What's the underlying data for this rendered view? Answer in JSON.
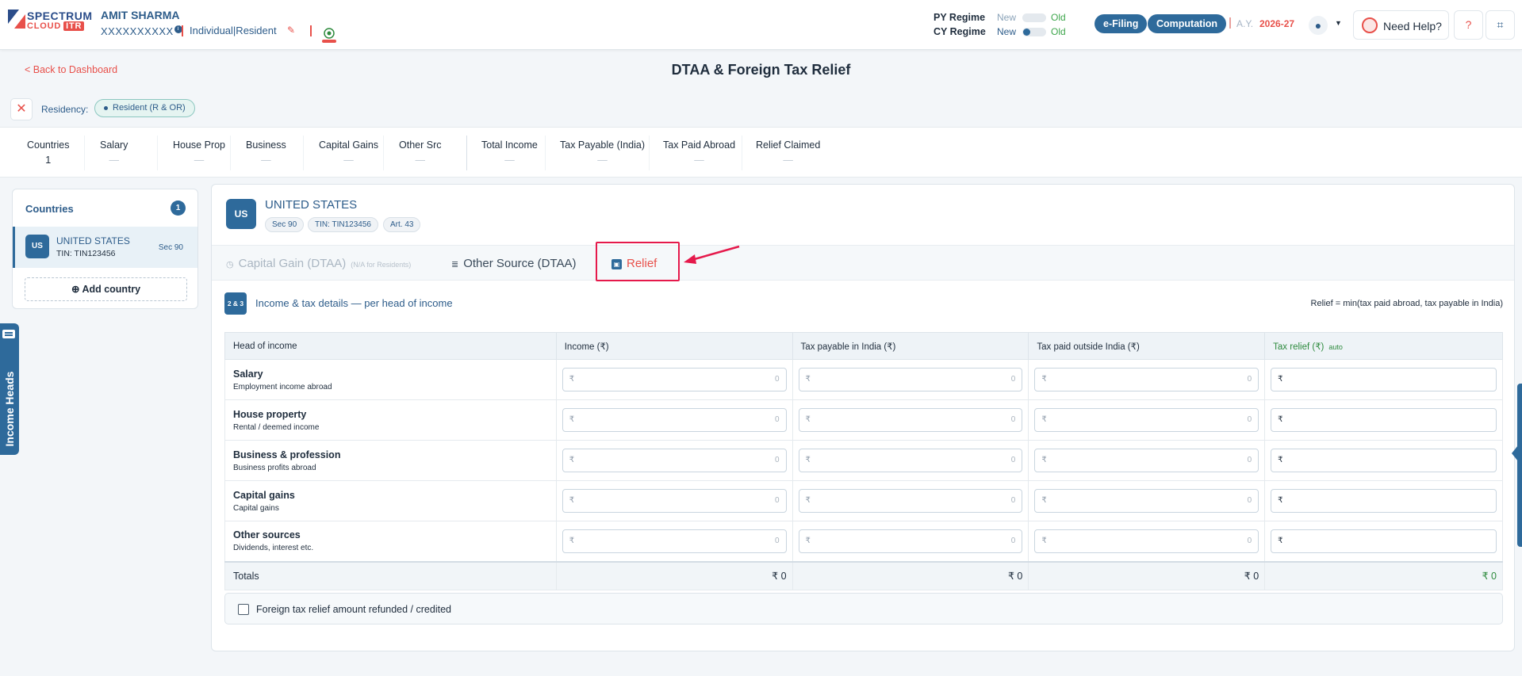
{
  "header": {
    "logo_line1": "SPECTRUM",
    "logo_line2": "CLOUD",
    "logo_badge": "ITR",
    "user_name": "AMIT SHARMA",
    "user_pan": "XXXXXXXXXX",
    "pan_badge": "i",
    "user_type": "Individual|Resident",
    "py_regime_label": "PY Regime",
    "cy_regime_label": "CY Regime",
    "new_label": "New",
    "old_label": "Old",
    "efiling_label": "e-Filing",
    "computation_label": "Computation",
    "ay_label": "A.Y.",
    "ay_value": "2026-27",
    "help_label": "Need Help?"
  },
  "page": {
    "back_label": "< Back to Dashboard",
    "title": "DTAA & Foreign Tax Relief",
    "residency_label": "Residency:",
    "residency_value": "Resident (R & OR)"
  },
  "summary": [
    {
      "label": "Countries",
      "value": "1"
    },
    {
      "label": "Salary",
      "value": "—"
    },
    {
      "label": "House Prop",
      "value": "—"
    },
    {
      "label": "Business",
      "value": "—"
    },
    {
      "label": "Capital Gains",
      "value": "—"
    },
    {
      "label": "Other Src",
      "value": "—"
    },
    {
      "label": "Total Income",
      "value": "—"
    },
    {
      "label": "Tax Payable (India)",
      "value": "—"
    },
    {
      "label": "Tax Paid Abroad",
      "value": "—"
    },
    {
      "label": "Relief Claimed",
      "value": "—"
    }
  ],
  "sidebar": {
    "title": "Countries",
    "count": "1",
    "country_code": "US",
    "country_name": "UNITED STATES",
    "country_tin": "TIN: TIN123456",
    "country_sec": "Sec 90",
    "add_label": "Add country",
    "side_tab_label": "Income Heads"
  },
  "country": {
    "code": "US",
    "name": "UNITED STATES",
    "chips": [
      "Sec 90",
      "TIN: TIN123456",
      "Art. 43"
    ]
  },
  "tabs": {
    "capital_gain": "Capital Gain (DTAA)",
    "capital_gain_note": "(N/A for Residents)",
    "other_source": "Other Source (DTAA)",
    "relief": "Relief"
  },
  "section": {
    "badge": "2 & 3",
    "title": "Income & tax details — per head of income",
    "formula": "Relief = min(tax paid abroad, tax payable in India)"
  },
  "table": {
    "headers": [
      "Head of income",
      "Income (₹)",
      "Tax payable in India (₹)",
      "Tax paid outside India (₹)",
      "Tax relief (₹)"
    ],
    "auto_label": "auto",
    "currency": "₹",
    "rows": [
      {
        "title": "Salary",
        "sub": "Employment income abroad",
        "income": "0",
        "tax_india": "0",
        "tax_abroad": "0"
      },
      {
        "title": "House property",
        "sub": "Rental / deemed income",
        "income": "0",
        "tax_india": "0",
        "tax_abroad": "0"
      },
      {
        "title": "Business & profession",
        "sub": "Business profits abroad",
        "income": "0",
        "tax_india": "0",
        "tax_abroad": "0"
      },
      {
        "title": "Capital gains",
        "sub": "Capital gains",
        "income": "0",
        "tax_india": "0",
        "tax_abroad": "0"
      },
      {
        "title": "Other sources",
        "sub": "Dividends, interest etc.",
        "income": "0",
        "tax_india": "0",
        "tax_abroad": "0"
      }
    ],
    "totals_label": "Totals",
    "totals": [
      "₹ 0",
      "₹ 0",
      "₹ 0",
      "₹ 0"
    ]
  },
  "refund_label": "Foreign tax relief amount refunded / credited",
  "colors": {
    "primary": "#2e6a9b",
    "accent": "#e8504a",
    "highlight": "#e5194b",
    "green": "#2e8b3e"
  }
}
